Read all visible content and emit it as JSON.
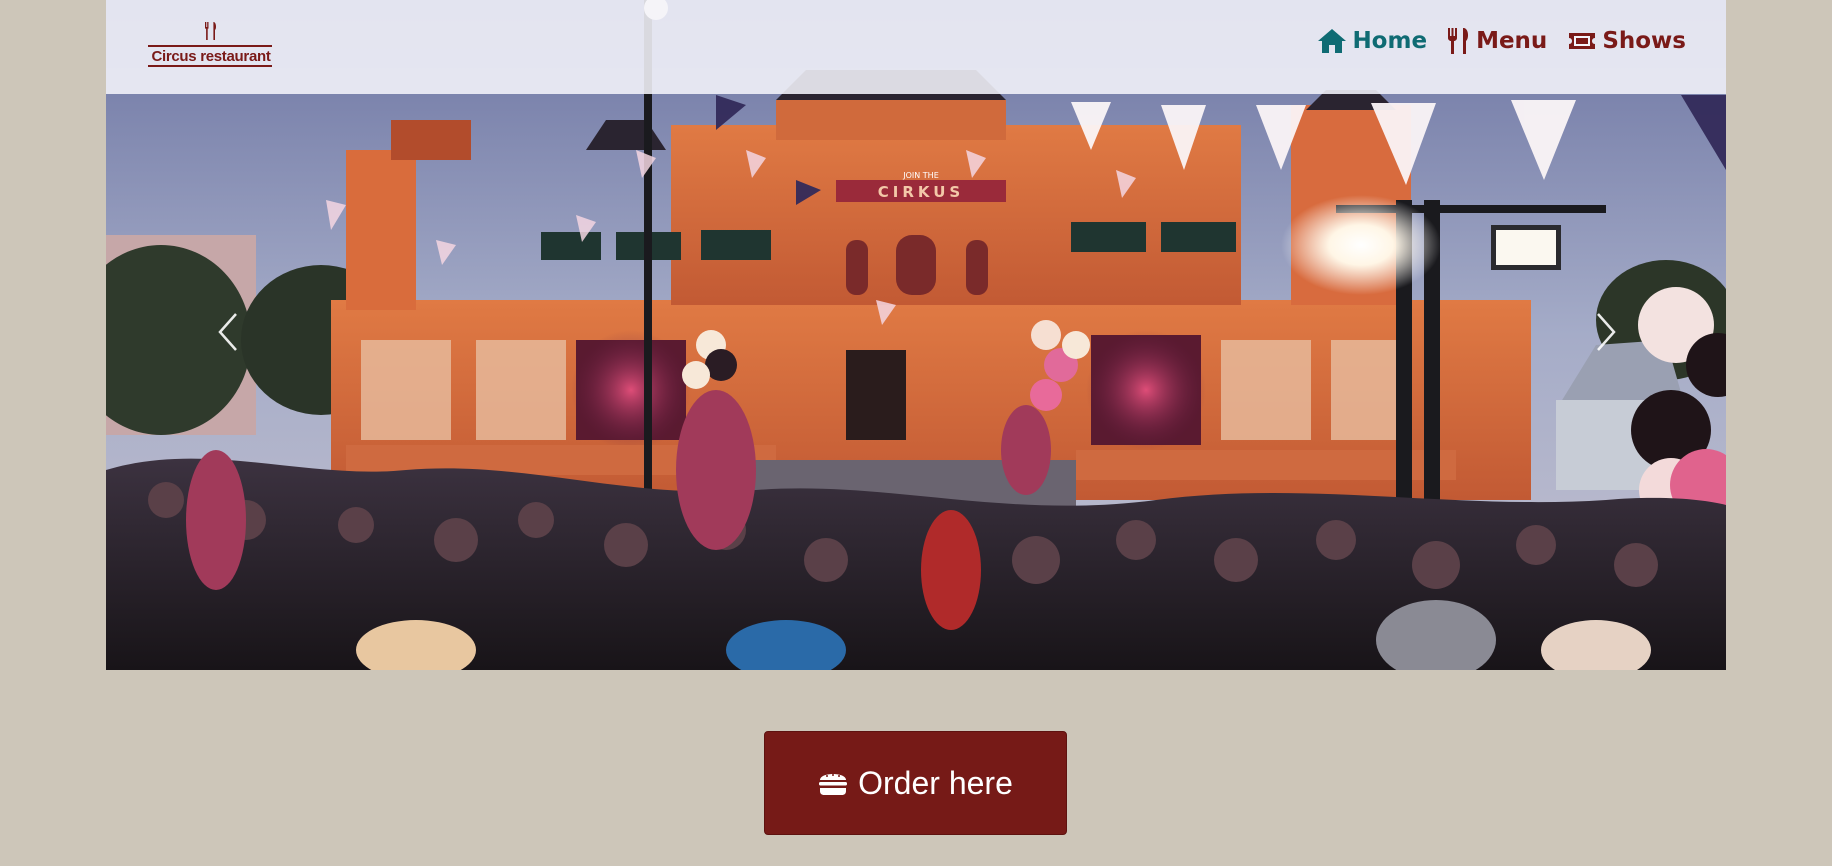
{
  "brand": {
    "name": "Circus restaurant",
    "color": "#7a1a18"
  },
  "nav": {
    "items": [
      {
        "label": "Home",
        "icon": "home-icon",
        "active": true
      },
      {
        "label": "Menu",
        "icon": "utensils-icon",
        "active": false
      },
      {
        "label": "Shows",
        "icon": "ticket-icon",
        "active": false
      }
    ],
    "active_color": "#0f6b73"
  },
  "hero": {
    "image_description": "Evening crowd in front of an illuminated orange circus building with bunting flags, balloons and stage lights",
    "sign_text": "CIRKUS",
    "sign_small_text": "JOIN THE",
    "controls": {
      "prev": "chevron-left-icon",
      "next": "chevron-right-icon"
    }
  },
  "cta": {
    "label": "Order here",
    "icon": "burger-icon",
    "color": "#761a17"
  },
  "colors": {
    "page_background": "#cdc6b9"
  }
}
